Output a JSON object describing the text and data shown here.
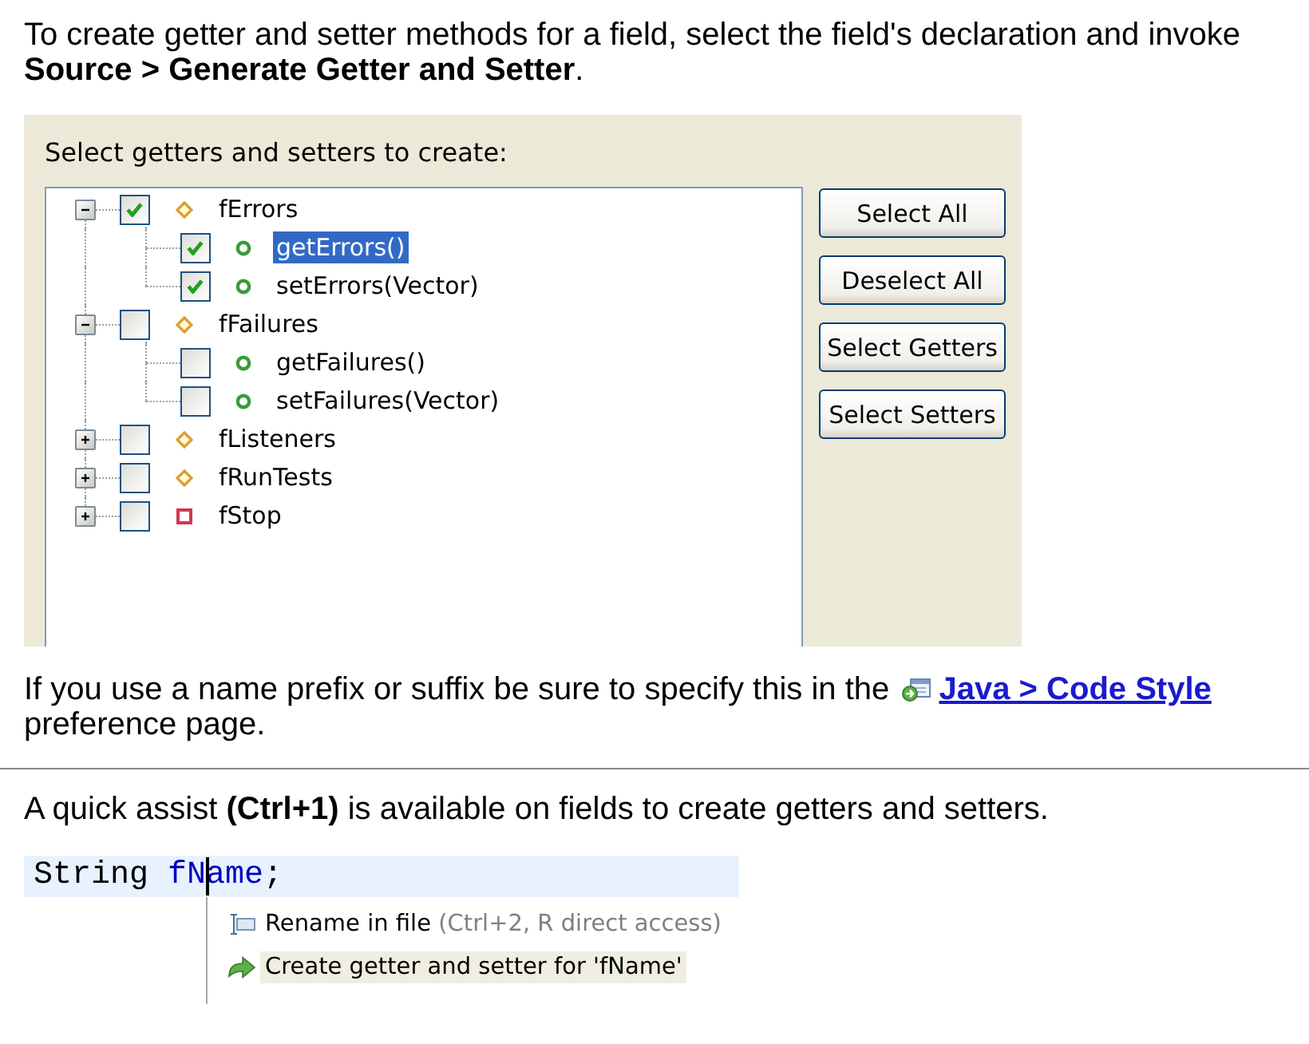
{
  "intro": {
    "text": "To create getter and setter methods for a field, select the field's declaration and invoke **Source > Generate Getter and Setter**."
  },
  "dialog": {
    "prompt": "Select getters and setters to create:",
    "tree": [
      {
        "label": "fErrors",
        "kind": "protected",
        "expanded": true,
        "checked": true,
        "selected": false,
        "children": [
          {
            "label": "getErrors()",
            "kind": "public",
            "checked": true,
            "selected": true
          },
          {
            "label": "setErrors(Vector)",
            "kind": "public",
            "checked": true,
            "selected": false
          }
        ]
      },
      {
        "label": "fFailures",
        "kind": "protected",
        "expanded": true,
        "checked": false,
        "selected": false,
        "children": [
          {
            "label": "getFailures()",
            "kind": "public",
            "checked": false,
            "selected": false
          },
          {
            "label": "setFailures(Vector)",
            "kind": "public",
            "checked": false,
            "selected": false
          }
        ]
      },
      {
        "label": "fListeners",
        "kind": "protected",
        "expanded": false,
        "checked": false,
        "selected": false
      },
      {
        "label": "fRunTests",
        "kind": "protected",
        "expanded": false,
        "checked": false,
        "selected": false
      },
      {
        "label": "fStop",
        "kind": "private",
        "expanded": false,
        "checked": false,
        "selected": false
      }
    ],
    "buttons": [
      {
        "label": "Select All"
      },
      {
        "label": "Deselect All"
      },
      {
        "label": "Select Getters"
      },
      {
        "label": "Select Setters"
      }
    ]
  },
  "note": {
    "text": "If you use a name prefix or suffix be sure to specify this in the",
    "link": "Java > Code Style",
    "text_after": "preference page."
  },
  "quick_assist": {
    "text": "A quick assist **(Ctrl+1)** is available on fields to create getters and setters."
  },
  "editor": {
    "code": [
      {
        "text": "String ",
        "kind": "type"
      },
      {
        "text": "fN",
        "kind": "field",
        "caret_after": true
      },
      {
        "text": "ame",
        "kind": "field"
      },
      {
        "text": ";",
        "kind": "punctuation"
      }
    ],
    "proposals": [
      {
        "label": "Rename in file",
        "hint": "(Ctrl+2, R direct access)",
        "kind": "rename",
        "selected": false
      },
      {
        "label": "Create getter and setter for 'fName'",
        "kind": "change",
        "selected": true
      }
    ]
  }
}
